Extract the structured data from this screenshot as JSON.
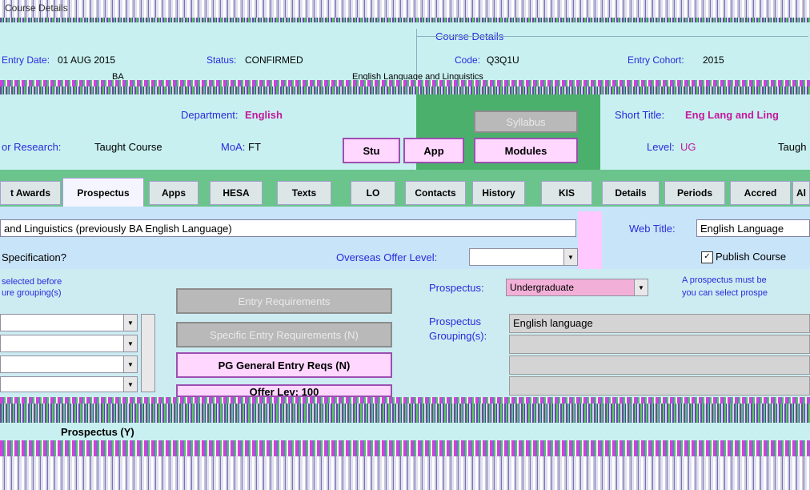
{
  "window": {
    "title": "Course Details"
  },
  "course_details": {
    "group_label": "Course Details",
    "entry_date_label": "Entry Date:",
    "entry_date": "01 AUG 2015",
    "status_label": "Status:",
    "status": "CONFIRMED",
    "code_label": "Code:",
    "code": "Q3Q1U",
    "entry_cohort_label": "Entry Cohort:",
    "entry_cohort": "2015",
    "award": "BA",
    "long_title": "English Language and Linguistics",
    "department_label": "Department:",
    "department": "English",
    "short_title_label": "Short Title:",
    "short_title": "Eng Lang and Ling",
    "taught_or_research_label": "or Research:",
    "taught_or_research": "Taught Course",
    "moa_label": "MoA:",
    "moa": "FT",
    "level_label": "Level:",
    "level": "UG",
    "taught_label": "Taugh"
  },
  "buttons": {
    "syllabus": "Syllabus",
    "stu": "Stu",
    "app": "App",
    "modules": "Modules"
  },
  "tabs": [
    {
      "label": "t Awards"
    },
    {
      "label": "Prospectus"
    },
    {
      "label": "Apps"
    },
    {
      "label": "HESA"
    },
    {
      "label": "Texts"
    },
    {
      "label": "LO"
    },
    {
      "label": "Contacts"
    },
    {
      "label": "History"
    },
    {
      "label": "KIS"
    },
    {
      "label": "Details"
    },
    {
      "label": "Periods"
    },
    {
      "label": "Accred"
    },
    {
      "label": "Al"
    }
  ],
  "prospectus_tab": {
    "title_value": "and Linguistics (previously BA English Language)",
    "web_title_label": "Web Title:",
    "web_title_value": "English Language",
    "specification_label": "Specification?",
    "overseas_offer_label": "Overseas Offer Level:",
    "overseas_offer_value": "",
    "publish_label": "Publish Course",
    "publish_checked": true,
    "hint_left_1": "selected before",
    "hint_left_2": "ure grouping(s)",
    "entry_requirements_button": "Entry Requirements",
    "specific_entry_button": "Specific Entry Requirements (N)",
    "pg_general_button": "PG General Entry Reqs (N)",
    "offer_lev_button": "Offer Lev: 100",
    "prospectus_label": "Prospectus:",
    "prospectus_value": "Undergraduate",
    "prospectus_hint_1": "A prospectus must be",
    "prospectus_hint_2": "you can select prospe",
    "grouping_label_1": "Prospectus",
    "grouping_label_2": "Grouping(s):",
    "grouping_values": [
      "English language",
      "",
      "",
      ""
    ],
    "prospectus_y_label": "Prospectus (Y)"
  }
}
